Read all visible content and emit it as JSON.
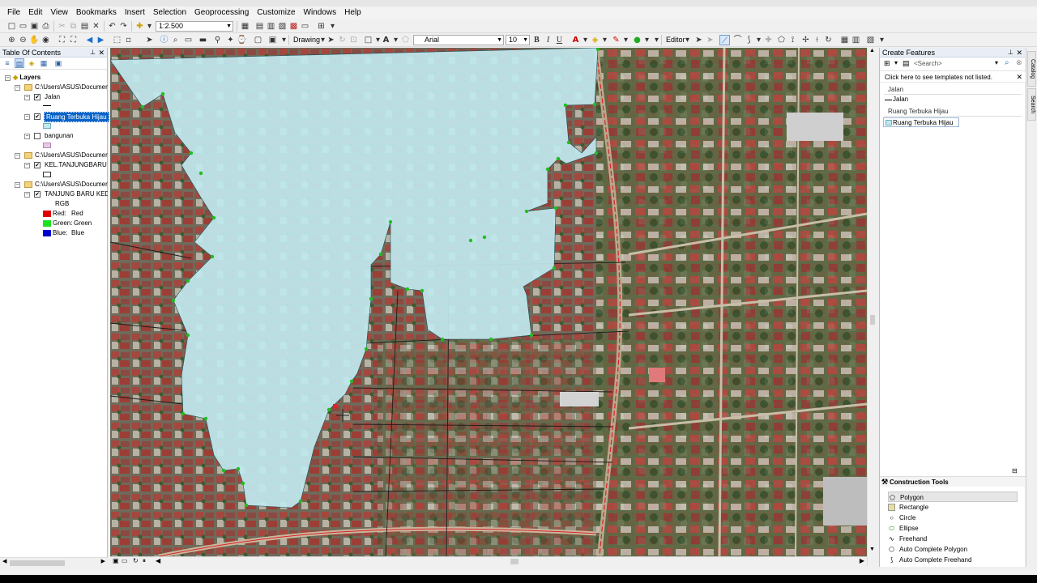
{
  "menu": [
    "File",
    "Edit",
    "View",
    "Bookmarks",
    "Insert",
    "Selection",
    "Geoprocessing",
    "Customize",
    "Windows",
    "Help"
  ],
  "toolbar": {
    "scale": "1:2.500",
    "drawing_label": "Drawing",
    "font_name": "Arial",
    "font_size": "10",
    "bold": "B",
    "italic": "I",
    "underline": "U",
    "editor_label": "Editor"
  },
  "toc": {
    "title": "Table Of Contents",
    "layers_root": "Layers",
    "group1_path": "C:\\Users\\ASUS\\Documen",
    "layer_jalan": "Jalan",
    "layer_rth": "Ruang Terbuka Hijau",
    "layer_bangunan": "bangunan",
    "group2_path": "C:\\Users\\ASUS\\Documen",
    "layer_kel": "KEL.TANJUNGBARU",
    "group3_path": "C:\\Users\\ASUS\\Documen",
    "layer_raster": "TANJUNG BARU KEDA",
    "rgb_label": "RGB",
    "red_label": "Red:",
    "red_value": "Red",
    "green_label": "Green:",
    "green_value": "Green",
    "blue_label": "Blue:",
    "blue_value": "Blue"
  },
  "create_features": {
    "title": "Create Features",
    "search_placeholder": "<Search>",
    "hint": "Click here to see templates not listed.",
    "group_jalan": "Jalan",
    "item_jalan": "Jalan",
    "group_rth": "Ruang Terbuka Hijau",
    "item_rth": "Ruang Terbuka Hijau"
  },
  "construction_tools": {
    "title": "Construction Tools",
    "items": [
      "Polygon",
      "Rectangle",
      "Circle",
      "Ellipse",
      "Freehand",
      "Auto Complete Polygon",
      "Auto Complete Freehand"
    ]
  },
  "sidetabs": [
    "Catalog",
    "Search"
  ],
  "colors": {
    "polygon_fill": "#bfe8ee",
    "vertex": "#1fbf1f",
    "road_red": "#d9222a",
    "selection_highlight": "#0a64c8"
  }
}
